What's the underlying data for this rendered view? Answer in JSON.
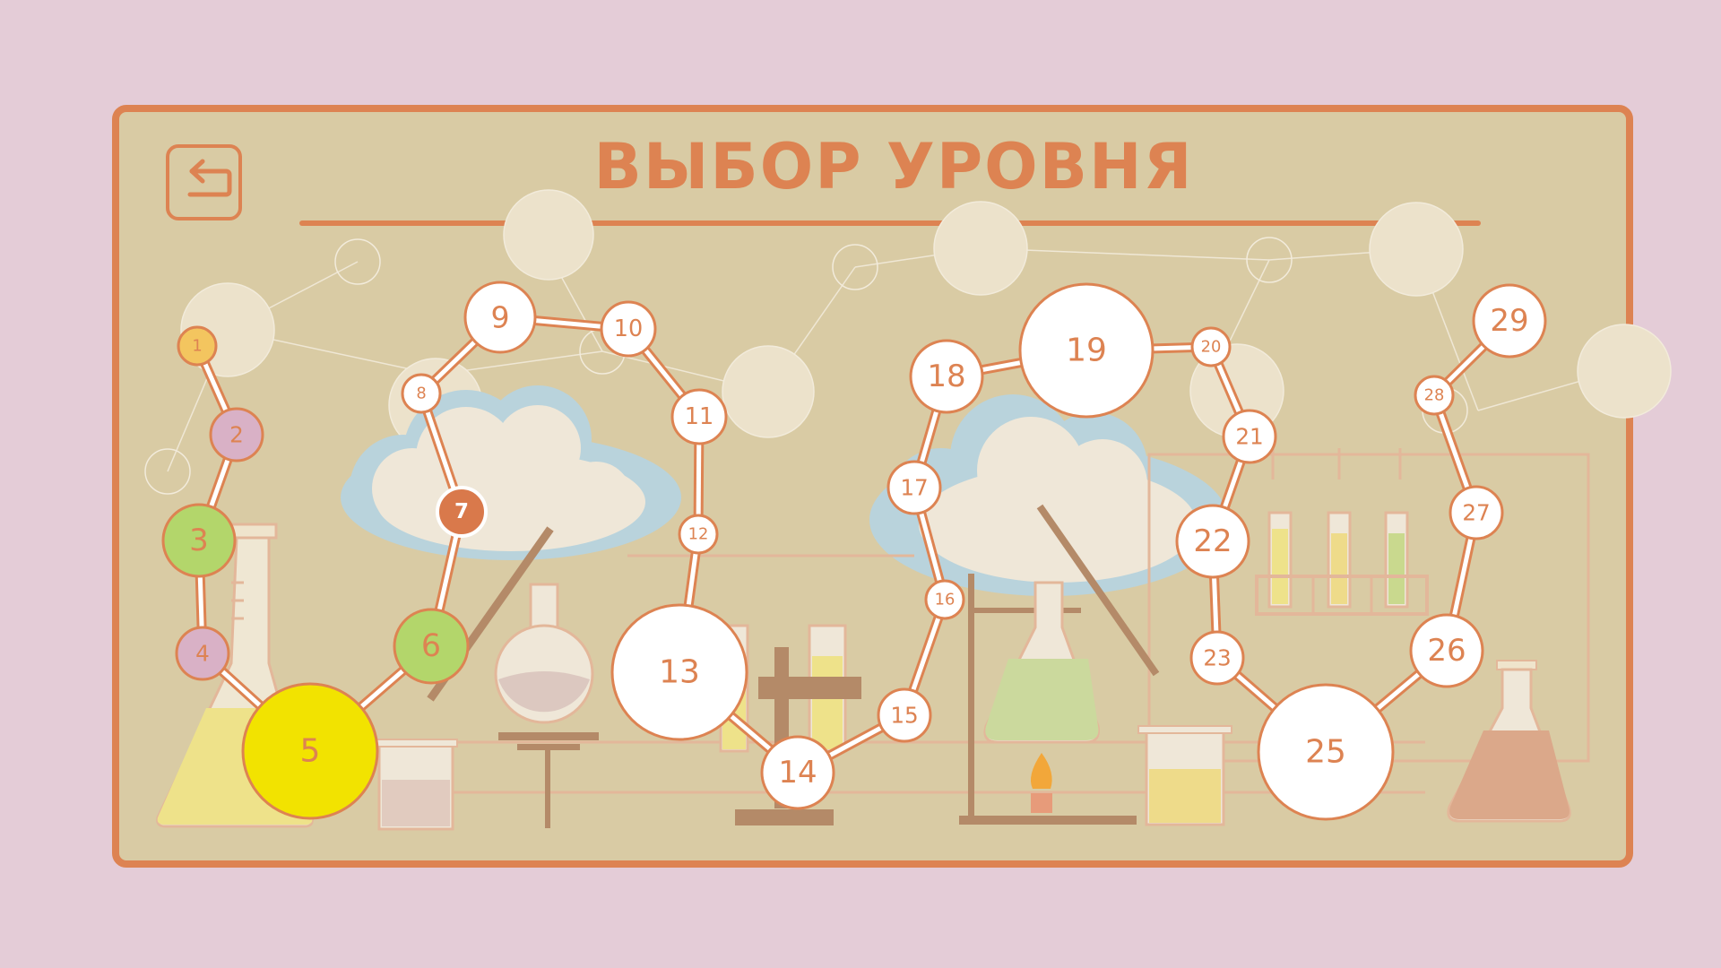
{
  "header": {
    "title": "ВЫБОР УРОВНЯ",
    "back_icon": "return-arrow-icon"
  },
  "colors": {
    "background": "#e4ccd7",
    "panel": "#d9cba4",
    "accent": "#dd8352",
    "node_fill": "#ffffff",
    "completed_yellow": "#f2e300",
    "completed_green": "#b3d66b",
    "completed_pink": "#d9b1c6",
    "completed_gold": "#f3c55f",
    "current": "#d9794b"
  },
  "levels": [
    {
      "label": "1",
      "state": "completed",
      "color": "completed_gold"
    },
    {
      "label": "2",
      "state": "completed",
      "color": "completed_pink"
    },
    {
      "label": "3",
      "state": "completed",
      "color": "completed_green"
    },
    {
      "label": "4",
      "state": "completed",
      "color": "completed_pink"
    },
    {
      "label": "5",
      "state": "completed",
      "color": "completed_yellow"
    },
    {
      "label": "6",
      "state": "completed",
      "color": "completed_green"
    },
    {
      "label": "7",
      "state": "current",
      "color": "current"
    },
    {
      "label": "8",
      "state": "locked"
    },
    {
      "label": "9",
      "state": "locked"
    },
    {
      "label": "10",
      "state": "locked"
    },
    {
      "label": "11",
      "state": "locked"
    },
    {
      "label": "12",
      "state": "locked"
    },
    {
      "label": "13",
      "state": "locked"
    },
    {
      "label": "14",
      "state": "locked"
    },
    {
      "label": "15",
      "state": "locked"
    },
    {
      "label": "16",
      "state": "locked"
    },
    {
      "label": "17",
      "state": "locked"
    },
    {
      "label": "18",
      "state": "locked"
    },
    {
      "label": "19",
      "state": "locked"
    },
    {
      "label": "20",
      "state": "locked"
    },
    {
      "label": "21",
      "state": "locked"
    },
    {
      "label": "22",
      "state": "locked"
    },
    {
      "label": "23",
      "state": "locked"
    },
    {
      "label": "25",
      "state": "locked"
    },
    {
      "label": "26",
      "state": "locked"
    },
    {
      "label": "27",
      "state": "locked"
    },
    {
      "label": "28",
      "state": "locked"
    },
    {
      "label": "29",
      "state": "locked"
    }
  ]
}
